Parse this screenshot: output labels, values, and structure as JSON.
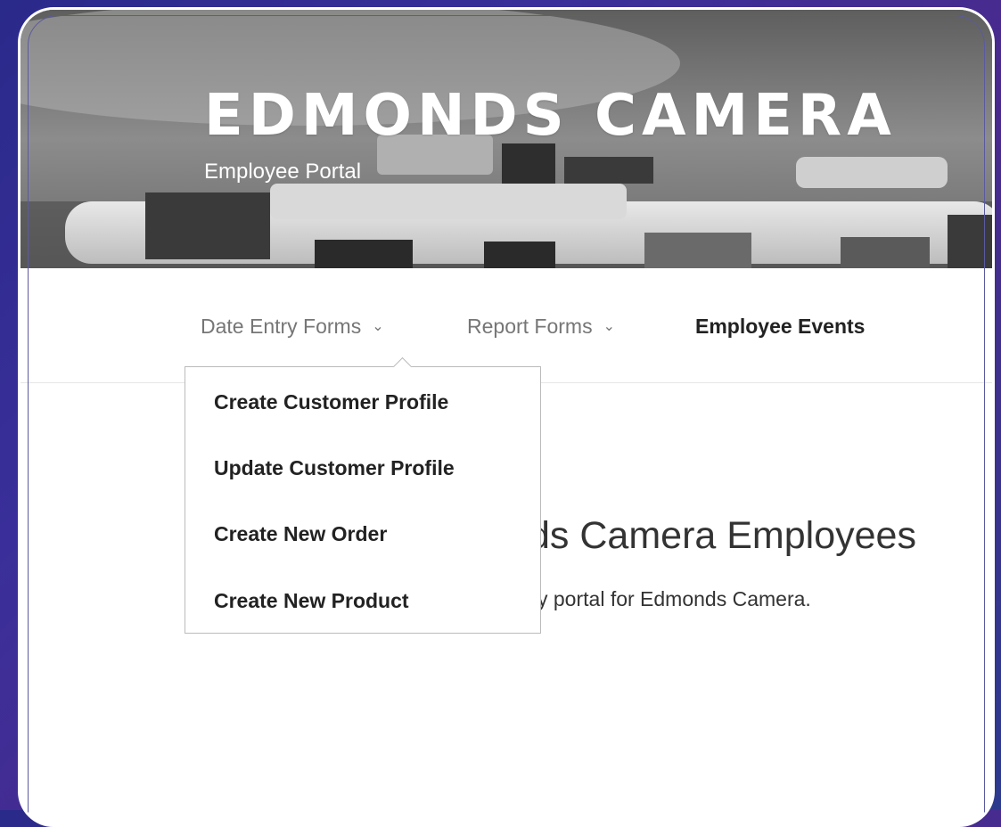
{
  "site": {
    "title": "EDMONDS CAMERA",
    "subtitle": "Employee Portal"
  },
  "nav": {
    "items": [
      {
        "label": "Date Entry Forms",
        "has_submenu": true,
        "icon": "chevron-down-icon",
        "glyph": "⌄"
      },
      {
        "label": "Report Forms",
        "has_submenu": true,
        "icon": "chevron-down-icon",
        "glyph": "⌄"
      },
      {
        "label": "Employee Events",
        "has_submenu": false
      }
    ]
  },
  "dropdown": {
    "open_for": "Date Entry Forms",
    "items": [
      {
        "label": "Create Customer Profile"
      },
      {
        "label": "Update Customer Profile"
      },
      {
        "label": "Create New Order"
      },
      {
        "label": "Create New Product"
      }
    ]
  },
  "content": {
    "heading_visible": "ds Camera Employees",
    "text_visible": "y portal for Edmonds Camera."
  },
  "colors": {
    "nav_inactive": "#767676",
    "nav_active": "#222222",
    "background_gradient_start": "#2a2a8a",
    "background_gradient_end": "#4a2a8c"
  }
}
